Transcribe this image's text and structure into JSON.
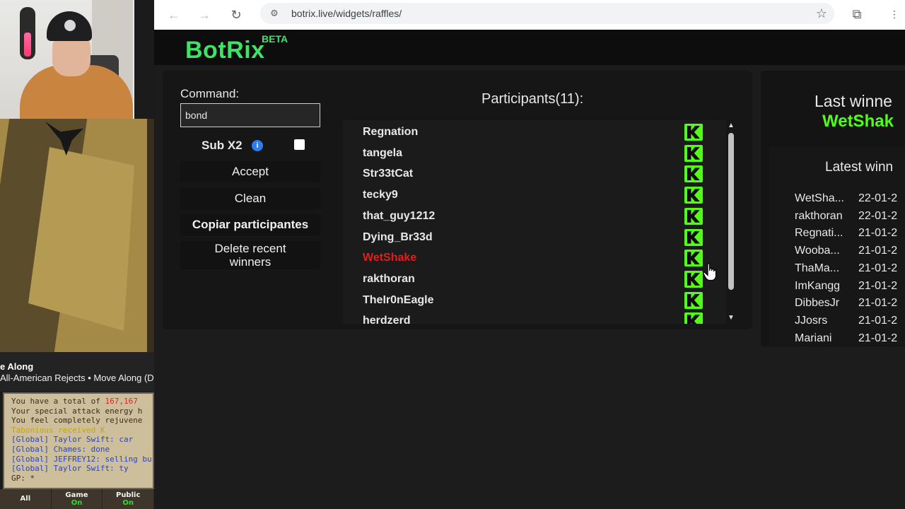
{
  "browser": {
    "url": "botrix.live/widgets/raffles/",
    "back_icon": "arrow-left",
    "forward_icon": "arrow-right",
    "reload_icon": "reload",
    "site_info_icon": "tune",
    "bookmark_icon": "star",
    "extensions_icon": "puzzle"
  },
  "header": {
    "logo": "BotRix",
    "badge": "BETA"
  },
  "controls": {
    "command_label": "Command:",
    "command_value": "bond",
    "sub_label": "Sub X2",
    "info_icon": "i",
    "accept": "Accept",
    "clean": "Clean",
    "copy": "Copiar participantes",
    "delete_recent": "Delete recent winners"
  },
  "participants": {
    "title": "Participants(11):",
    "items": [
      {
        "name": "Regnation"
      },
      {
        "name": "tangela"
      },
      {
        "name": "Str33tCat"
      },
      {
        "name": "tecky9"
      },
      {
        "name": "that_guy1212"
      },
      {
        "name": "Dying_Br33d"
      },
      {
        "name": "WetShake",
        "winner": true
      },
      {
        "name": "rakthoran"
      },
      {
        "name": "TheIr0nEagle"
      },
      {
        "name": "herdzerd"
      }
    ]
  },
  "winners": {
    "last_label": "Last winne",
    "last_name": "WetShak",
    "latest_label": "Latest winn",
    "rows": [
      {
        "name": "WetSha...",
        "date": "22-01-2"
      },
      {
        "name": "rakthoran",
        "date": "22-01-2"
      },
      {
        "name": "Regnati...",
        "date": "21-01-2"
      },
      {
        "name": "Wooba...",
        "date": "21-01-2"
      },
      {
        "name": "ThaMa...",
        "date": "21-01-2"
      },
      {
        "name": "ImKangg",
        "date": "21-01-2"
      },
      {
        "name": "DibbesJr",
        "date": "21-01-2"
      },
      {
        "name": "JJosrs",
        "date": "21-01-2"
      },
      {
        "name": "Mariani",
        "date": "21-01-2"
      }
    ]
  },
  "stream": {
    "song_title": "e Along",
    "song_artist": "All-American Rejects • Move Along (Deluxe E",
    "chat": [
      {
        "text": "You have a total of ",
        "hl": "167,167"
      },
      {
        "text": "Your special attack energy h"
      },
      {
        "text": "You feel completely rejuvene"
      },
      {
        "text": "Tabonious received K"
      },
      {
        "text": "[Global] Taylor Swift: car"
      },
      {
        "text": "[Global] Chames: done"
      },
      {
        "text": "[Global] JEFFREY12: selling bu"
      },
      {
        "text": "[Global] Taylor Swift: ty"
      },
      {
        "text": "GP: *"
      }
    ],
    "tabs": [
      {
        "label": "All",
        "state": ""
      },
      {
        "label": "Game",
        "state": "On"
      },
      {
        "label": "Public",
        "state": "On"
      }
    ]
  }
}
